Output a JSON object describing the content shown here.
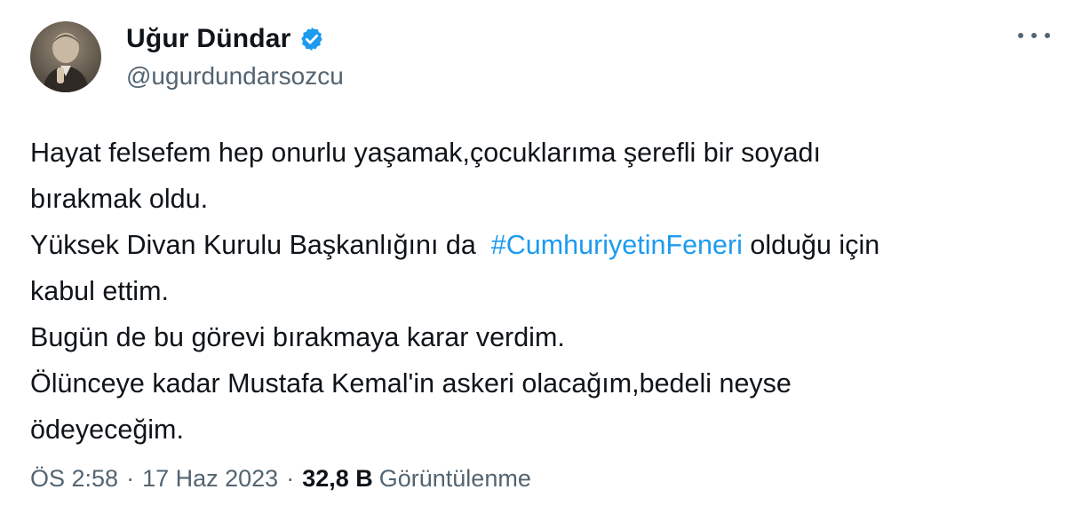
{
  "author": {
    "display_name": "Uğur Dündar",
    "handle": "@ugurdundarsozcu",
    "verified_icon": "verified-badge-icon",
    "avatar": "avatar-photo"
  },
  "menu": {
    "icon": "more-options-icon"
  },
  "tweet": {
    "line1": "Hayat felsefem hep onurlu yaşamak,çocuklarıma şerefli bir soyadı",
    "line2": "bırakmak oldu.",
    "line3_before": "Yüksek Divan Kurulu Başkanlığını da ",
    "hashtag": "#CumhuriyetinFeneri",
    "line3_after": " olduğu için",
    "line4": "kabul ettim.",
    "line5": "Bugün de bu görevi bırakmaya karar verdim.",
    "line6": "Ölünceye kadar Mustafa Kemal'in askeri olacağım,bedeli neyse",
    "line7": "ödeyeceğim."
  },
  "meta": {
    "time": "ÖS 2:58",
    "separator": "·",
    "date": "17 Haz 2023",
    "views_count": "32,8 B",
    "views_label": "Görüntülenme"
  },
  "colors": {
    "link": "#1d9bf0",
    "secondary_text": "#536471",
    "primary_text": "#0f1419",
    "verified": "#1d9bf0"
  }
}
